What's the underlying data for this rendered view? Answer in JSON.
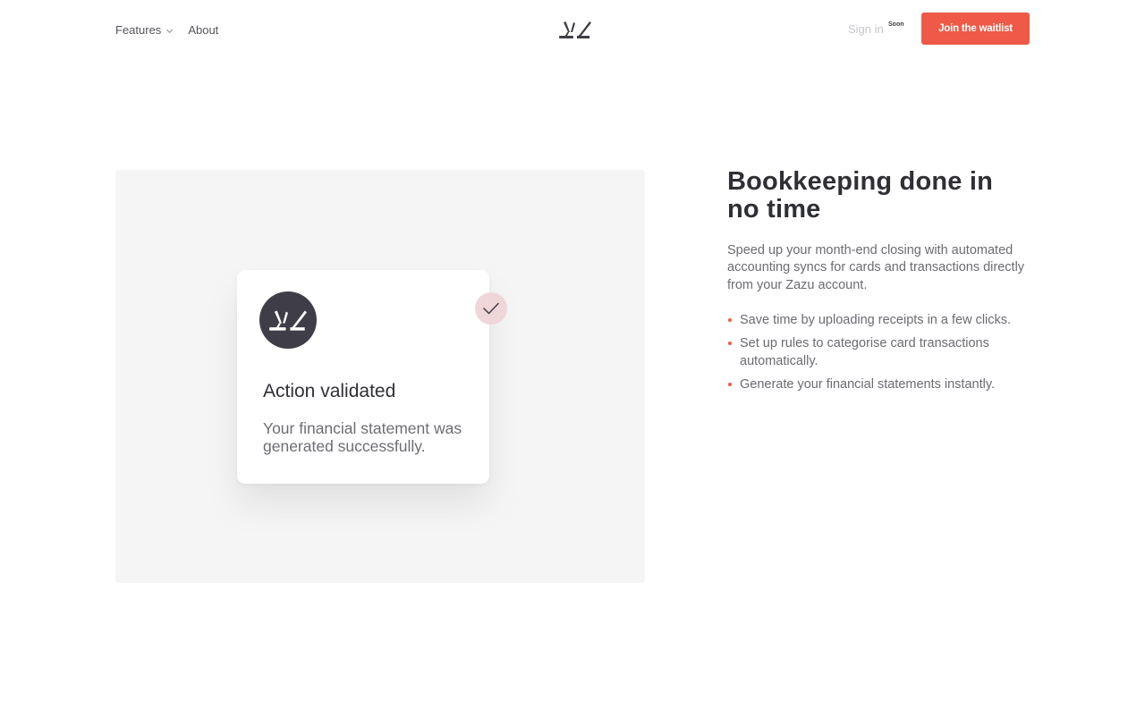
{
  "header": {
    "nav": [
      {
        "label": "Features"
      },
      {
        "label": "About"
      }
    ],
    "logo_icon": "zazu-logo-icon",
    "sign_in_label": "Sign in",
    "sign_in_badge": "Soon",
    "cta_label": "Join the waitlist"
  },
  "illustration": {
    "card_title": "Action validated",
    "card_body": "Your financial statement was generated successfully.",
    "avatar_icon": "zazu-logo-icon",
    "check_icon": "checkmark-icon"
  },
  "content": {
    "headline": "Bookkeeping done in no time",
    "intro": "Speed up your month-end closing with automated accounting syncs for cards and transactions directly from your Zazu account.",
    "bullets": [
      "Save time by uploading receipts in a few clicks.",
      "Set up rules to categorise card transactions automatically.",
      "Generate your financial statements instantly."
    ]
  },
  "colors": {
    "accent": "#ee5a47",
    "dark": "#3f3e48",
    "panel": "#f5f5f5",
    "check_bg": "#efd6d8"
  }
}
